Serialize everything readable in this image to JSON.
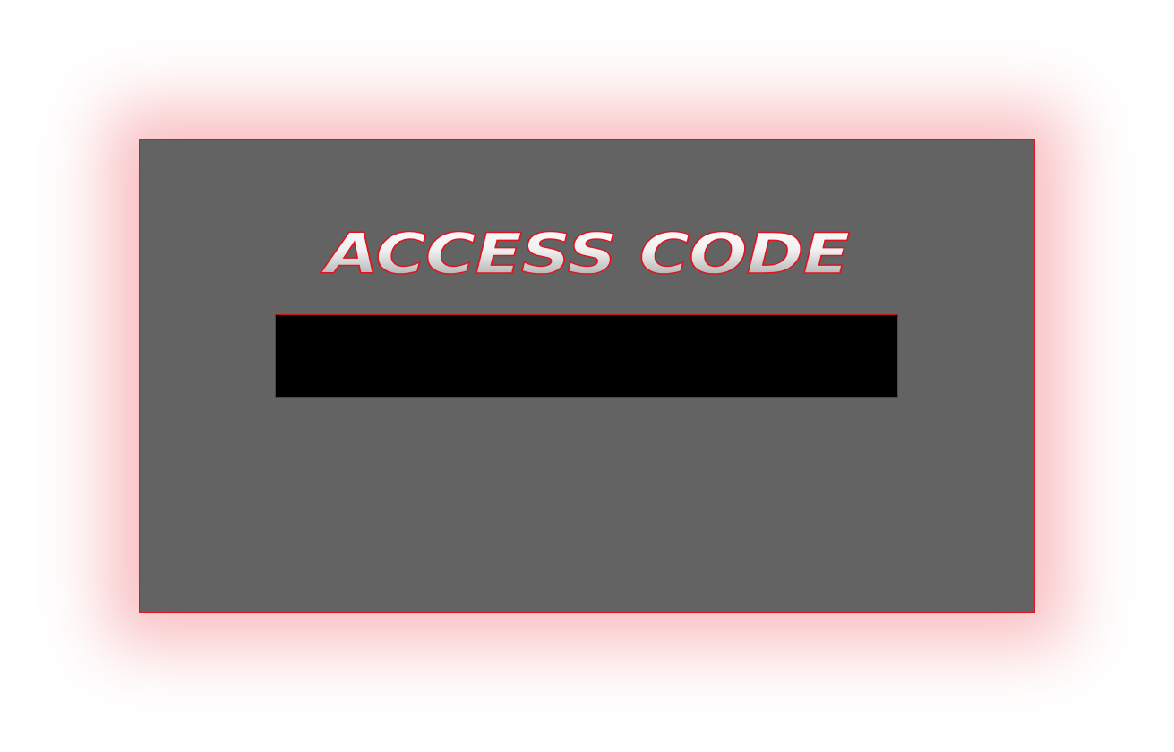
{
  "panel": {
    "title": "ACCESS CODE",
    "input": {
      "value": "",
      "placeholder": ""
    }
  },
  "colors": {
    "background": "#ffffff",
    "panel_fill": "#636363",
    "accent_red": "#e0141e",
    "input_fill": "#000000",
    "title_gradient_top": "#ffffff",
    "title_gradient_bottom": "#9a9a9a"
  }
}
